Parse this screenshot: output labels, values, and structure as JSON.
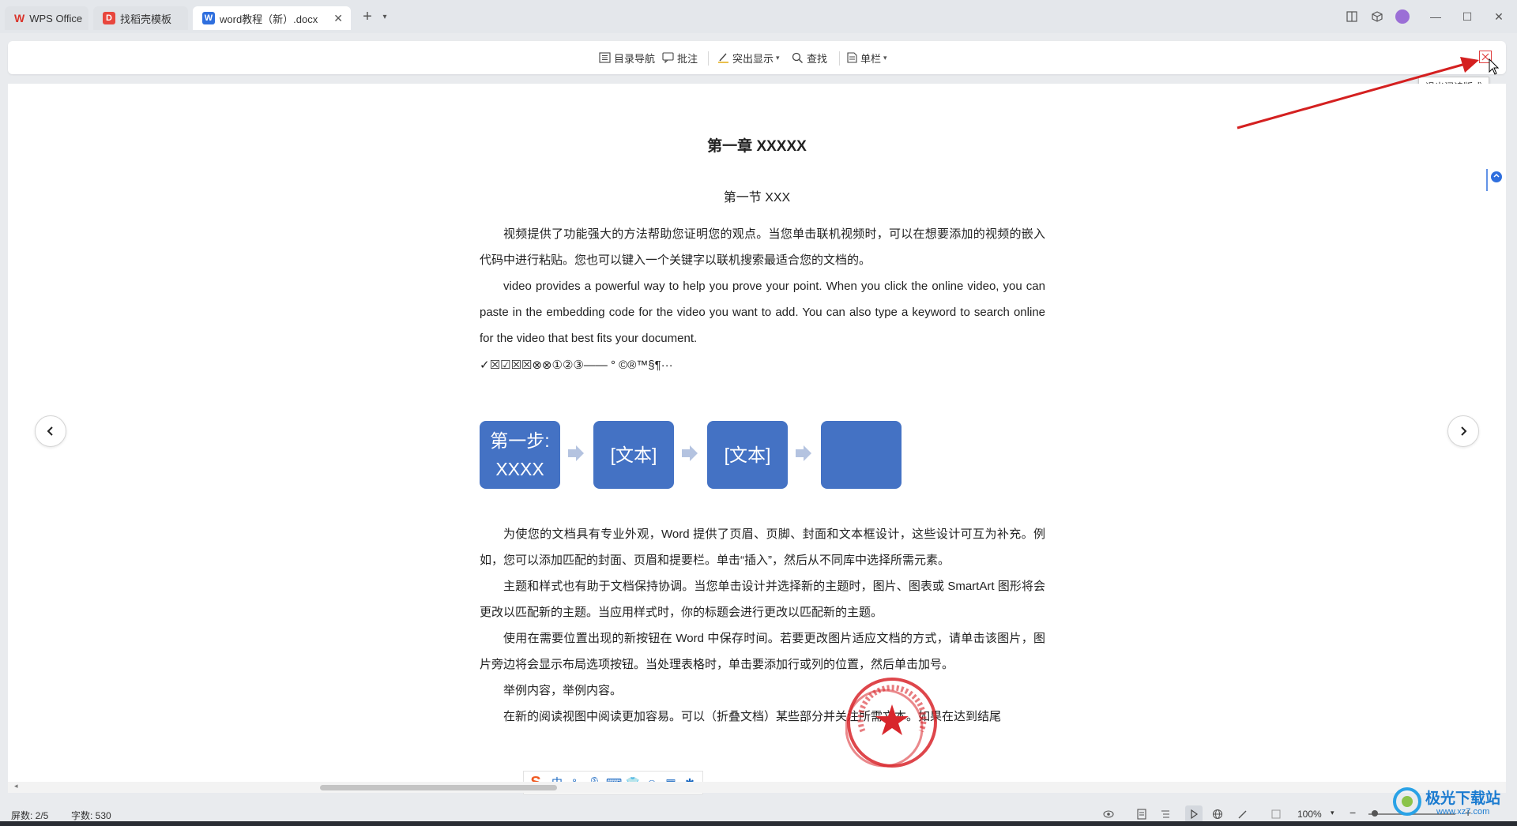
{
  "tabs": [
    {
      "label": "WPS Office",
      "icon": "wps-logo-icon"
    },
    {
      "label": "找稻壳模板",
      "icon": "docer-logo-icon"
    },
    {
      "label": "word教程（新）.docx",
      "icon": "word-doc-icon",
      "active": true
    }
  ],
  "toolbar": {
    "toc_nav": "目录导航",
    "comment": "批注",
    "highlight": "突出显示",
    "find": "查找",
    "column": "单栏",
    "exit_tooltip": "退出阅读版式"
  },
  "document": {
    "heading1": "第一章  XXXXX",
    "heading2": "第一节  XXX",
    "para1": "视频提供了功能强大的方法帮助您证明您的观点。当您单击联机视频时，可以在想要添加的视频的嵌入代码中进行粘贴。您也可以键入一个关键字以联机搜索最适合您的文档的。",
    "para2": "video provides a powerful way to help you prove your point. When you click the online video, you can paste in the embedding code for the video you want to add. You can also type a keyword to search online for the video that best fits your document.",
    "symbols": "✓☒☑☒☒⊗⊗①②③——  °  ©®™§¶···",
    "flow": {
      "box1_line1": "第一步:",
      "box1_line2": "XXXX",
      "box2": "[文本]",
      "box3": "[文本]",
      "box4": ""
    },
    "para3": "为使您的文档具有专业外观，Word 提供了页眉、页脚、封面和文本框设计，这些设计可互为补充。例如，您可以添加匹配的封面、页眉和提要栏。单击“插入”，然后从不同库中选择所需元素。",
    "para4": "主题和样式也有助于文档保持协调。当您单击设计并选择新的主题时，图片、图表或 SmartArt 图形将会更改以匹配新的主题。当应用样式时，你的标题会进行更改以匹配新的主题。",
    "para5": "使用在需要位置出现的新按钮在 Word 中保存时间。若要更改图片适应文档的方式，请单击该图片，图片旁边将会显示布局选项按钮。当处理表格时，单击要添加行或列的位置，然后单击加号。",
    "para6": "举例内容，举例内容。",
    "para7": "在新的阅读视图中阅读更加容易。可以（折叠文档）某些部分并关注所需文本。如果在达到结尾"
  },
  "ime": {
    "mode": "中"
  },
  "status": {
    "screen": "屏数: 2/5",
    "words": "字数: 530",
    "zoom": "100%"
  },
  "watermark": {
    "text": "极光下载站",
    "url": "www.xz7.com"
  },
  "colors": {
    "accent": "#4472c4",
    "stamp": "#d8262c",
    "arrow": "#d42020"
  }
}
